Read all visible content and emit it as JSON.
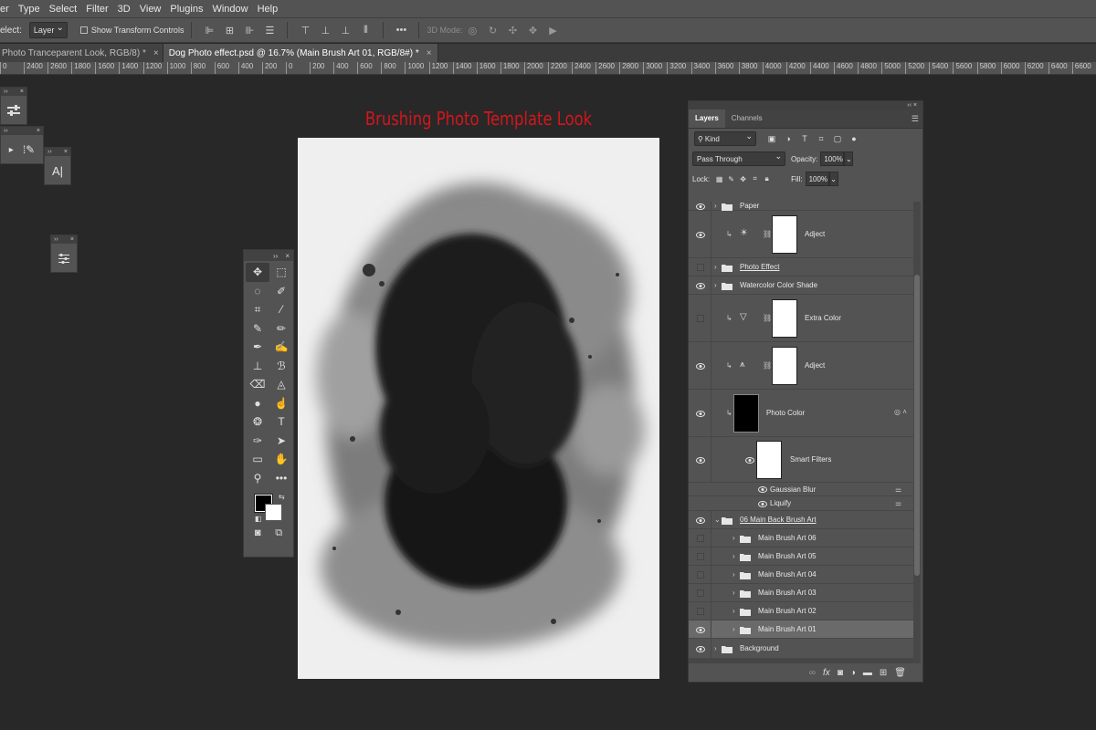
{
  "menu": {
    "items": [
      "er",
      "Type",
      "Select",
      "Filter",
      "3D",
      "View",
      "Plugins",
      "Window",
      "Help"
    ]
  },
  "options": {
    "select_label": "elect:",
    "select_value": "Layer",
    "show_transform": "Show Transform Controls",
    "mode_3d": "3D Mode:"
  },
  "tabs": [
    {
      "label": "Photo Tranceparent Look, RGB/8) *"
    },
    {
      "label": "Dog Photo effect.psd @ 16.7% (Main Brush Art 01, RGB/8#) *"
    }
  ],
  "ruler": {
    "ticks": [
      "0",
      "2400",
      "2600",
      "1800",
      "1600",
      "1400",
      "1200",
      "1000",
      "800",
      "600",
      "400",
      "200",
      "0",
      "200",
      "400",
      "600",
      "800",
      "1000",
      "1200",
      "1400",
      "1600",
      "1800",
      "2000",
      "2200",
      "2400",
      "2600",
      "2800",
      "3000",
      "3200",
      "3400",
      "3600",
      "3800",
      "4000",
      "4200",
      "4400",
      "4600",
      "4800",
      "5000",
      "5200",
      "5400",
      "5600",
      "5800",
      "6000",
      "6200",
      "6400",
      "6600"
    ]
  },
  "floating": {
    "char_panel_glyph": "A|"
  },
  "document": {
    "title": "Brushing Photo Template Look"
  },
  "layers_panel": {
    "tab_layers": "Layers",
    "tab_channels": "Channels",
    "kind": "Kind",
    "blend_mode": "Pass Through",
    "opacity_label": "Opacity:",
    "opacity_value": "100%",
    "lock_label": "Lock:",
    "fill_label": "Fill:",
    "fill_value": "100%",
    "layers": [
      {
        "name": "Paper",
        "type": "group",
        "visible": true
      },
      {
        "name": "Adject",
        "type": "adjustment",
        "visible": true
      },
      {
        "name": "Photo Effect",
        "type": "group",
        "visible": false
      },
      {
        "name": "Watercolor Color Shade",
        "type": "group",
        "visible": true
      },
      {
        "name": "Extra Color",
        "type": "adjustment",
        "visible": false
      },
      {
        "name": "Adject",
        "type": "adjustment",
        "visible": true
      },
      {
        "name": "Photo Color",
        "type": "smart",
        "visible": true
      },
      {
        "name": "Smart Filters",
        "type": "filtermask",
        "visible": true
      },
      {
        "name": "Gaussian Blur",
        "type": "filter",
        "visible": true
      },
      {
        "name": "Liquify",
        "type": "filter",
        "visible": true
      },
      {
        "name": "06 Main  Back Brush Art",
        "type": "group",
        "visible": true
      },
      {
        "name": "Main Brush Art 06",
        "type": "group",
        "visible": false
      },
      {
        "name": "Main Brush Art 05",
        "type": "group",
        "visible": false
      },
      {
        "name": "Main Brush Art 04",
        "type": "group",
        "visible": false
      },
      {
        "name": "Main Brush Art 03",
        "type": "group",
        "visible": false
      },
      {
        "name": "Main Brush Art 02",
        "type": "group",
        "visible": false
      },
      {
        "name": "Main Brush Art 01",
        "type": "group",
        "visible": true,
        "selected": true
      },
      {
        "name": "Background",
        "type": "group",
        "visible": true
      }
    ]
  },
  "colors": {
    "title_red": "#d3161c",
    "panel": "#535353",
    "workspace": "#282828"
  }
}
